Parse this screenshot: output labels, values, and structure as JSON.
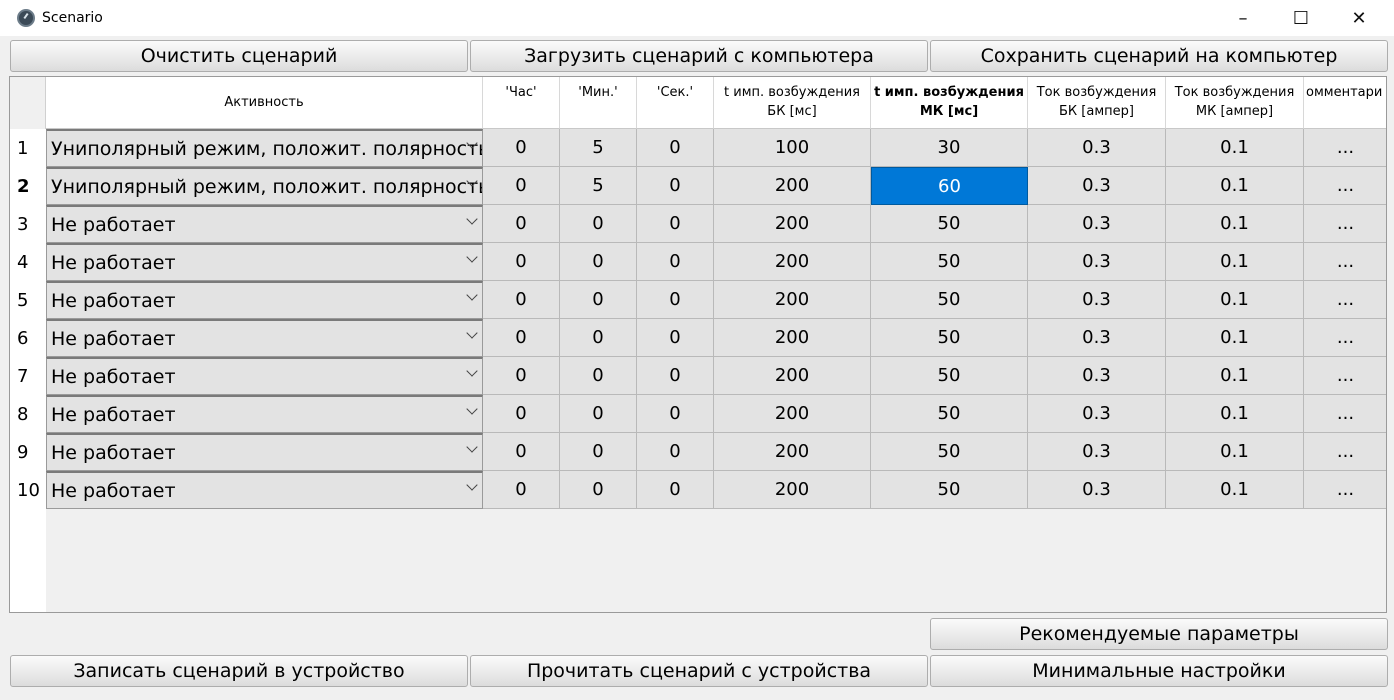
{
  "window": {
    "title": "Scenario",
    "minimize": "–",
    "maximize": "☐",
    "close": "✕"
  },
  "toolbar_top": {
    "clear": "Очистить сценарий",
    "load": "Загрузить сценарий с компьютера",
    "save": "Сохранить сценарий на компьютер"
  },
  "table": {
    "columns": [
      "Активность",
      "'Час'",
      "'Мин.'",
      "'Сек.'",
      "t имп. возбуждения БК [мс]",
      "t имп. возбуждения МК [мс]",
      "Ток возбуждения БК [ампер]",
      "Ток возбуждения МК [ампер]",
      "омментари"
    ],
    "rows": [
      {
        "n": "1",
        "activity": "Униполярный режим, положит. полярность",
        "h": "0",
        "m": "5",
        "s": "0",
        "tbk": "100",
        "tmk": "30",
        "ibk": "0.3",
        "imk": "0.1",
        "comment": "..."
      },
      {
        "n": "2",
        "activity": "Униполярный режим, положит. полярность",
        "h": "0",
        "m": "5",
        "s": "0",
        "tbk": "200",
        "tmk": "60",
        "ibk": "0.3",
        "imk": "0.1",
        "comment": "..."
      },
      {
        "n": "3",
        "activity": "Не работает",
        "h": "0",
        "m": "0",
        "s": "0",
        "tbk": "200",
        "tmk": "50",
        "ibk": "0.3",
        "imk": "0.1",
        "comment": "..."
      },
      {
        "n": "4",
        "activity": "Не работает",
        "h": "0",
        "m": "0",
        "s": "0",
        "tbk": "200",
        "tmk": "50",
        "ibk": "0.3",
        "imk": "0.1",
        "comment": "..."
      },
      {
        "n": "5",
        "activity": "Не работает",
        "h": "0",
        "m": "0",
        "s": "0",
        "tbk": "200",
        "tmk": "50",
        "ibk": "0.3",
        "imk": "0.1",
        "comment": "..."
      },
      {
        "n": "6",
        "activity": "Не работает",
        "h": "0",
        "m": "0",
        "s": "0",
        "tbk": "200",
        "tmk": "50",
        "ibk": "0.3",
        "imk": "0.1",
        "comment": "..."
      },
      {
        "n": "7",
        "activity": "Не работает",
        "h": "0",
        "m": "0",
        "s": "0",
        "tbk": "200",
        "tmk": "50",
        "ibk": "0.3",
        "imk": "0.1",
        "comment": "..."
      },
      {
        "n": "8",
        "activity": "Не работает",
        "h": "0",
        "m": "0",
        "s": "0",
        "tbk": "200",
        "tmk": "50",
        "ibk": "0.3",
        "imk": "0.1",
        "comment": "..."
      },
      {
        "n": "9",
        "activity": "Не работает",
        "h": "0",
        "m": "0",
        "s": "0",
        "tbk": "200",
        "tmk": "50",
        "ibk": "0.3",
        "imk": "0.1",
        "comment": "..."
      },
      {
        "n": "10",
        "activity": "Не работает",
        "h": "0",
        "m": "0",
        "s": "0",
        "tbk": "200",
        "tmk": "50",
        "ibk": "0.3",
        "imk": "0.1",
        "comment": "..."
      }
    ]
  },
  "toolbar_bottom": {
    "recommended": "Рекомендуемые параметры",
    "write": "Записать сценарий в устройство",
    "read": "Прочитать сценарий с устройства",
    "minimal": "Минимальные настройки"
  },
  "colors": {
    "selection": "#0078d7",
    "cell_bg": "#e3e3e3"
  }
}
